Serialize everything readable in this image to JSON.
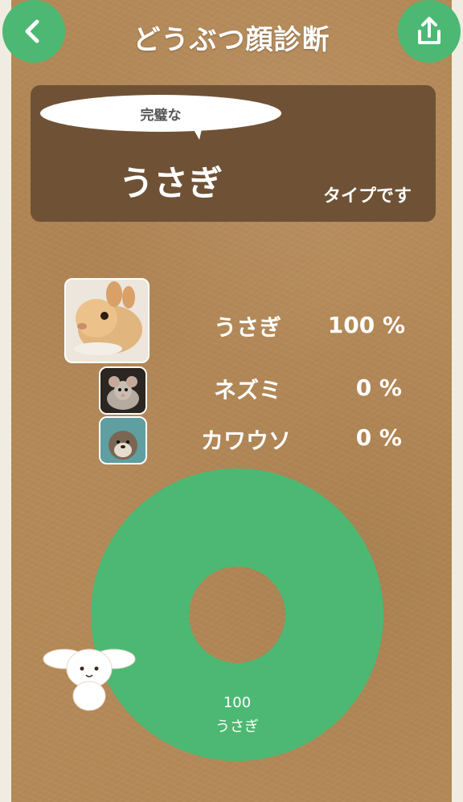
{
  "header": {
    "title": "どうぶつ顔診断",
    "back_icon": "chevron-left-icon",
    "share_icon": "share-icon"
  },
  "result": {
    "qualifier": "完璧な",
    "animal": "うさぎ",
    "suffix": "タイプです"
  },
  "ranking": [
    {
      "name": "うさぎ",
      "percent_text": "100 %",
      "percent": 100,
      "image": "rabbit-photo"
    },
    {
      "name": "ネズミ",
      "percent_text": "0 %",
      "percent": 0,
      "image": "mouse-photo"
    },
    {
      "name": "カワウソ",
      "percent_text": "0 %",
      "percent": 0,
      "image": "otter-photo"
    }
  ],
  "chart_data": {
    "type": "pie",
    "style": "donut",
    "slices": [
      {
        "label": "うさぎ",
        "value": 100
      }
    ],
    "colors": {
      "primary": "#4cb873"
    }
  },
  "colors": {
    "accent": "#4cb873",
    "result_box": "#6f5235",
    "background": "#b48958"
  }
}
